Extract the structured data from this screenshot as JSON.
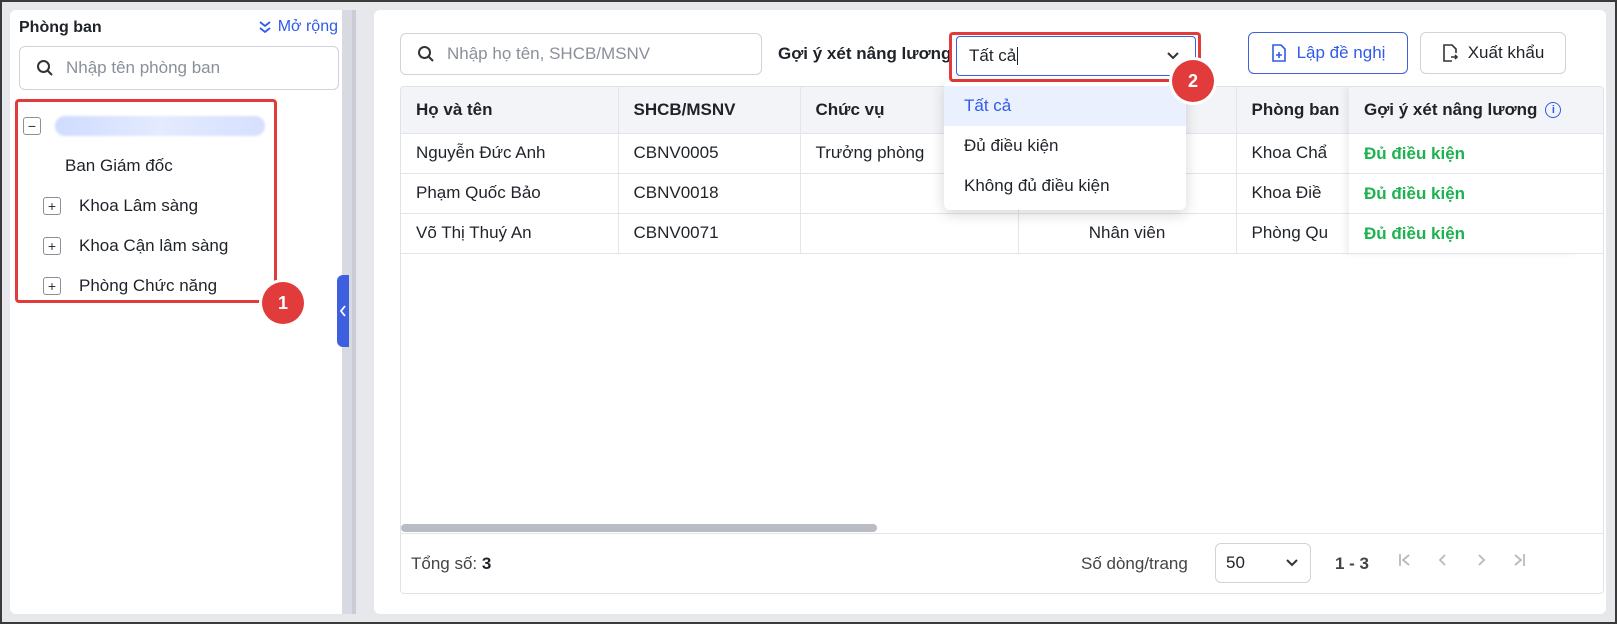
{
  "sidebar": {
    "title": "Phòng ban",
    "expand_label": "Mở rộng",
    "search_placeholder": "Nhập tên phòng ban",
    "tree": [
      {
        "label": "Ban Giám đốc",
        "expandable": false
      },
      {
        "label": "Khoa Lâm sàng",
        "expandable": true
      },
      {
        "label": "Khoa Cận lâm sàng",
        "expandable": true
      },
      {
        "label": "Phòng Chức năng",
        "expandable": true
      }
    ]
  },
  "badges": {
    "one": "1",
    "two": "2"
  },
  "toolbar": {
    "search_placeholder": "Nhập họ tên, SHCB/MSNV",
    "filter_label": "Gợi ý xét nâng lương",
    "filter_value": "Tất cả",
    "propose_label": "Lập đề nghị",
    "export_label": "Xuất khẩu"
  },
  "dropdown": {
    "options": [
      "Tất cả",
      "Đủ điều kiện",
      "Không đủ điều kiện"
    ],
    "selected_index": 0
  },
  "table": {
    "columns": [
      "Họ và tên",
      "SHCB/MSNV",
      "Chức vụ",
      "",
      "Phòng ban",
      "Gợi ý xét nâng lương"
    ],
    "rows": [
      {
        "name": "Nguyễn Đức Anh",
        "code": "CBNV0005",
        "position": "Trưởng phòng",
        "title": "",
        "dept": "Khoa Chẩ",
        "suggest": "Đủ điều kiện"
      },
      {
        "name": "Phạm Quốc Bảo",
        "code": "CBNV0018",
        "position": "",
        "title": "",
        "dept": "Khoa Điề",
        "suggest": "Đủ điều kiện"
      },
      {
        "name": "Võ Thị Thuý An",
        "code": "CBNV0071",
        "position": "",
        "title": "Nhân viên",
        "dept": "Phòng Qu",
        "suggest": "Đủ điều kiện"
      }
    ]
  },
  "footer": {
    "total_label": "Tổng số:",
    "total_value": "3",
    "rows_per_page_label": "Số dòng/trang",
    "rows_per_page_value": "50",
    "range": "1 - 3"
  },
  "colors": {
    "accent": "#2f5bea",
    "highlight": "#e23b3b",
    "success": "#1db24f"
  }
}
